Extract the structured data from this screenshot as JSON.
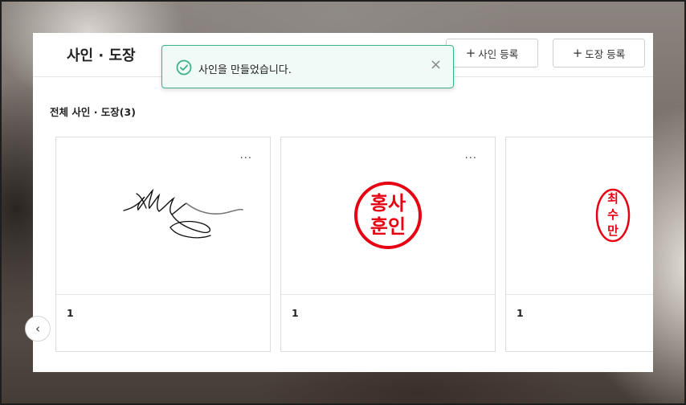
{
  "page": {
    "title": "사인 · 도장",
    "add_sign_label": "사인 등록",
    "add_stamp_label": "도장 등록",
    "plus_glyph": "+"
  },
  "toast": {
    "message": "사인을 만들었습니다.",
    "icon": "check-circle-icon",
    "close_glyph": "×",
    "accent": "#3bb38a"
  },
  "section": {
    "title": "전체 사인 · 도장(3)"
  },
  "cards": [
    {
      "type": "signature",
      "name": "1",
      "menu": "···"
    },
    {
      "type": "stamp",
      "name": "1",
      "menu": "···",
      "stamp_lines": [
        "홍사",
        "훈인"
      ],
      "color": "#e60012"
    },
    {
      "type": "stamp",
      "name": "1",
      "stamp_lines": [
        "최",
        "수",
        "만"
      ],
      "color": "#e60012"
    }
  ],
  "nav": {
    "prev_glyph": "‹"
  }
}
